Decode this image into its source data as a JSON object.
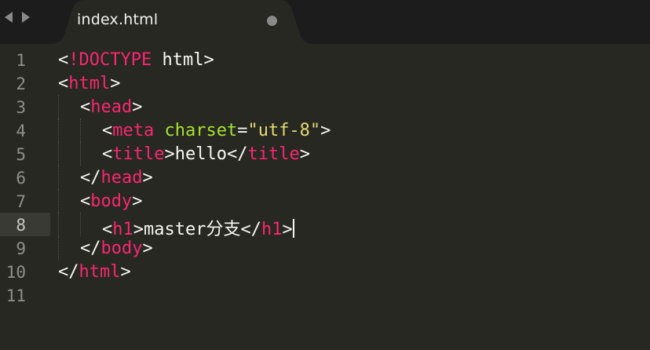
{
  "tabbar": {
    "back_icon": "triangle-left-icon",
    "forward_icon": "triangle-right-icon",
    "active_tab": {
      "title": "index.html",
      "dirty_indicator": "circle-dot-icon"
    }
  },
  "editor": {
    "current_line": 8,
    "line_numbers": [
      "1",
      "2",
      "3",
      "4",
      "5",
      "6",
      "7",
      "8",
      "9",
      "10",
      "11"
    ],
    "lines": {
      "l1": {
        "open": "<",
        "decl": "!DOCTYPE",
        "rest": " html",
        "close": ">"
      },
      "l2": {
        "open": "<",
        "tag": "html",
        "close": ">"
      },
      "l3": {
        "open": "<",
        "tag": "head",
        "close": ">"
      },
      "l4": {
        "open": "<",
        "tag": "meta",
        "space": " ",
        "attr": "charset",
        "eq": "=",
        "value": "\"utf-8\"",
        "close": ">"
      },
      "l5": {
        "open": "<",
        "tag": "title",
        "close": ">",
        "text": "hello",
        "open2": "</",
        "tag2": "title",
        "close2": ">"
      },
      "l6": {
        "open": "</",
        "tag": "head",
        "close": ">"
      },
      "l7": {
        "open": "<",
        "tag": "body",
        "close": ">"
      },
      "l8": {
        "open": "<",
        "tag": "h1",
        "close": ">",
        "text": "master分支",
        "open2": "</",
        "tag2": "h1",
        "close2": ">"
      },
      "l9": {
        "open": "</",
        "tag": "body",
        "close": ">"
      },
      "l10": {
        "open": "</",
        "tag": "html",
        "close": ">"
      }
    }
  },
  "colors": {
    "background": "#272822",
    "tag": "#f92672",
    "attribute": "#a6e22e",
    "string": "#e6db74",
    "text": "#f8f8f2",
    "line_number": "#8f908a"
  }
}
